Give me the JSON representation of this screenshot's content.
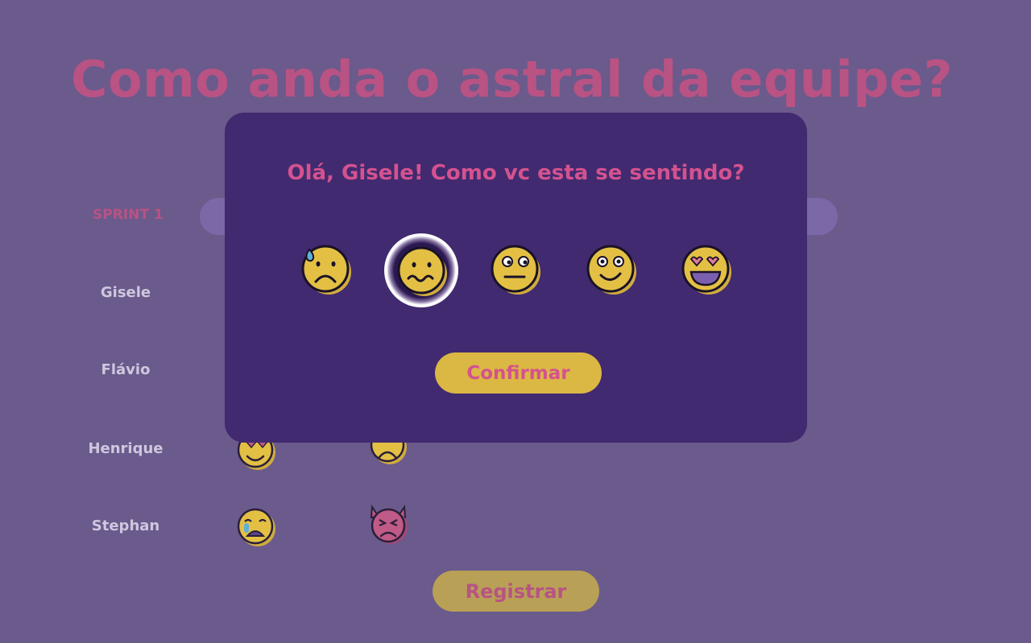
{
  "header": {
    "title": "Como anda o astral da equipe?"
  },
  "sprint": {
    "label": "SPRINT 1"
  },
  "team": {
    "members": [
      {
        "name": "Gisele",
        "moods": []
      },
      {
        "name": "Flávio",
        "moods": []
      },
      {
        "name": "Henrique",
        "moods": [
          "in-love-emoji-icon",
          "sad-emoji-icon"
        ]
      },
      {
        "name": "Stephan",
        "moods": [
          "crying-emoji-icon",
          "angry-devil-emoji-icon"
        ]
      }
    ]
  },
  "actions": {
    "register_label": "Registrar"
  },
  "modal": {
    "question": "Olá, Gisele! Como vc esta se sentindo?",
    "confirm_label": "Confirmar",
    "selected_index": 1,
    "options": [
      {
        "icon": "sweating-sad-emoji-icon"
      },
      {
        "icon": "confused-emoji-icon"
      },
      {
        "icon": "neutral-emoji-icon"
      },
      {
        "icon": "smiling-emoji-icon"
      },
      {
        "icon": "heart-eyes-emoji-icon"
      }
    ]
  },
  "colors": {
    "background": "#6b5a8c",
    "modal_background": "#412a70",
    "accent_pink": "#d4528e",
    "emoji_yellow": "#e3c044",
    "button_yellow": "#dbb744"
  }
}
